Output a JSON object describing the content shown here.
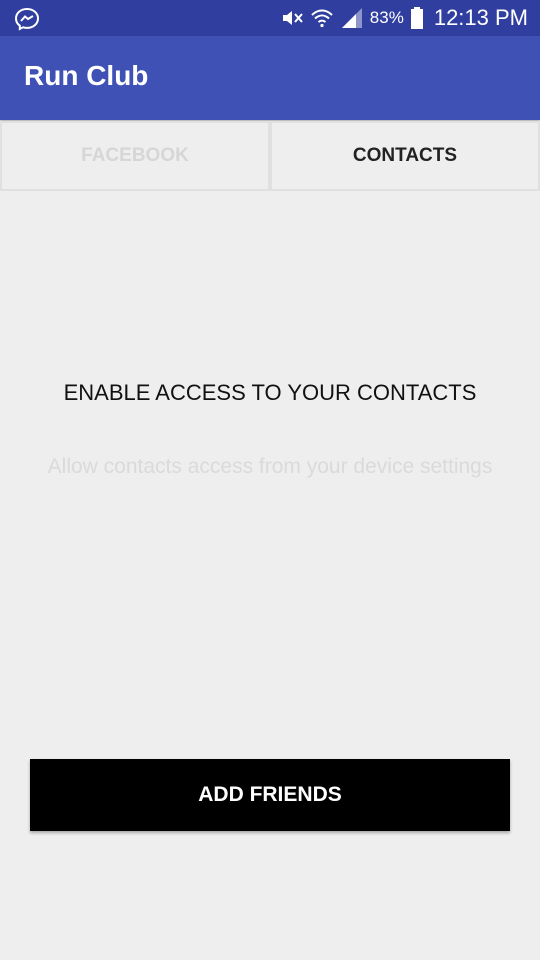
{
  "status_bar": {
    "icons": {
      "left": "messenger-icon",
      "mute": "mute-icon",
      "wifi": "wifi-icon",
      "signal": "signal-icon",
      "battery": "battery-icon"
    },
    "battery_percent": "83%",
    "time": "12:13 PM"
  },
  "app_bar": {
    "title": "Run Club",
    "color": "#3f51b5"
  },
  "tabs": [
    {
      "label": "FACEBOOK",
      "active": false
    },
    {
      "label": "CONTACTS",
      "active": true
    }
  ],
  "main": {
    "title": "ENABLE ACCESS TO YOUR CONTACTS",
    "subtitle": "Allow contacts access from your device settings"
  },
  "action": {
    "button_label": "ADD FRIENDS"
  }
}
